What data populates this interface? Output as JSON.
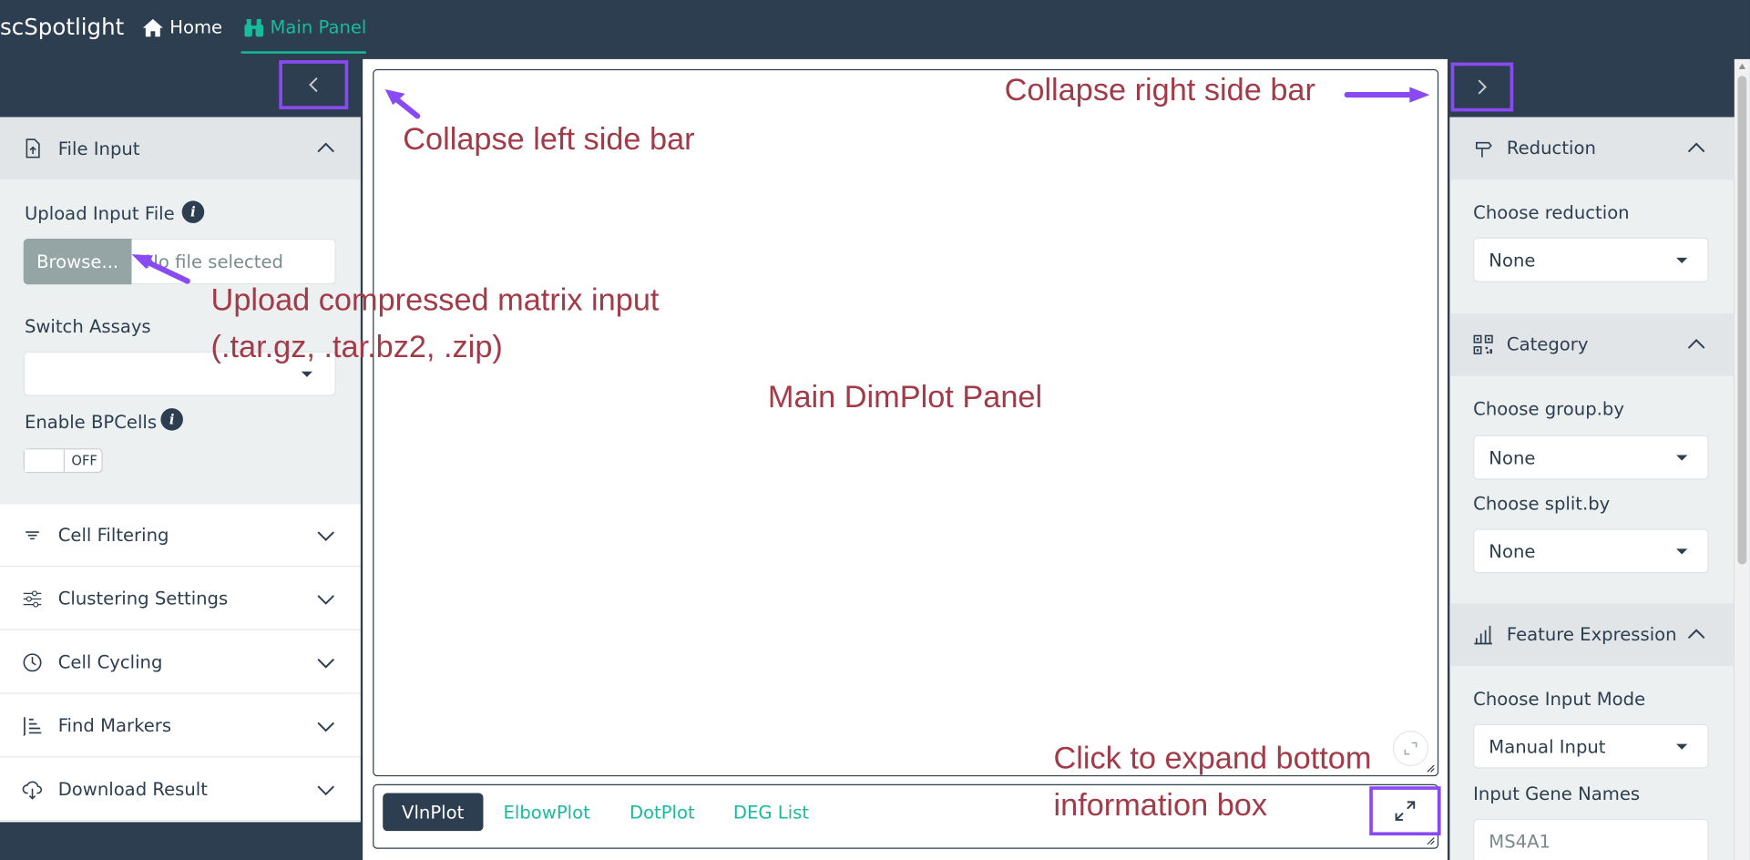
{
  "navbar": {
    "brand": "scSpotlight",
    "home_label": "Home",
    "main_panel_label": "Main Panel"
  },
  "left_sidebar": {
    "file_input": {
      "title": "File Input",
      "upload_label": "Upload Input File",
      "browse_label": "Browse...",
      "file_placeholder": "No file selected",
      "switch_assays_label": "Switch Assays",
      "switch_assays_value": "",
      "bpcells_label": "Enable BPCells",
      "bpcells_toggle": "OFF"
    },
    "sections": [
      {
        "label": "Cell Filtering",
        "icon": "filter-icon"
      },
      {
        "label": "Clustering Settings",
        "icon": "sliders-icon"
      },
      {
        "label": "Cell Cycling",
        "icon": "clock-icon"
      },
      {
        "label": "Find Markers",
        "icon": "sort-bars-icon"
      },
      {
        "label": "Download Result",
        "icon": "cloud-download-icon"
      }
    ]
  },
  "main": {
    "tabs": [
      "VlnPlot",
      "ElbowPlot",
      "DotPlot",
      "DEG List"
    ],
    "active_tab": "VlnPlot"
  },
  "right_sidebar": {
    "reduction": {
      "title": "Reduction",
      "choose_label": "Choose reduction",
      "choose_value": "None"
    },
    "category": {
      "title": "Category",
      "group_by_label": "Choose group.by",
      "group_by_value": "None",
      "split_by_label": "Choose split.by",
      "split_by_value": "None"
    },
    "feature_expression": {
      "title": "Feature Expression",
      "input_mode_label": "Choose Input Mode",
      "input_mode_value": "Manual Input",
      "gene_names_label": "Input Gene Names",
      "gene_names_value": "MS4A1"
    }
  },
  "annotations": {
    "collapse_left": "Collapse left side bar",
    "collapse_right": "Collapse right side bar",
    "upload_line1": "Upload compressed matrix input",
    "upload_line2": "(.tar.gz, .tar.bz2, .zip)",
    "main_panel": "Main DimPlot Panel",
    "expand_line1": "Click to expand bottom",
    "expand_line2": "information box"
  },
  "colors": {
    "navbar": "#2c3e50",
    "accent": "#18bc9c",
    "highlight_box": "#8a4af3",
    "annotation_text": "#a33a48"
  }
}
